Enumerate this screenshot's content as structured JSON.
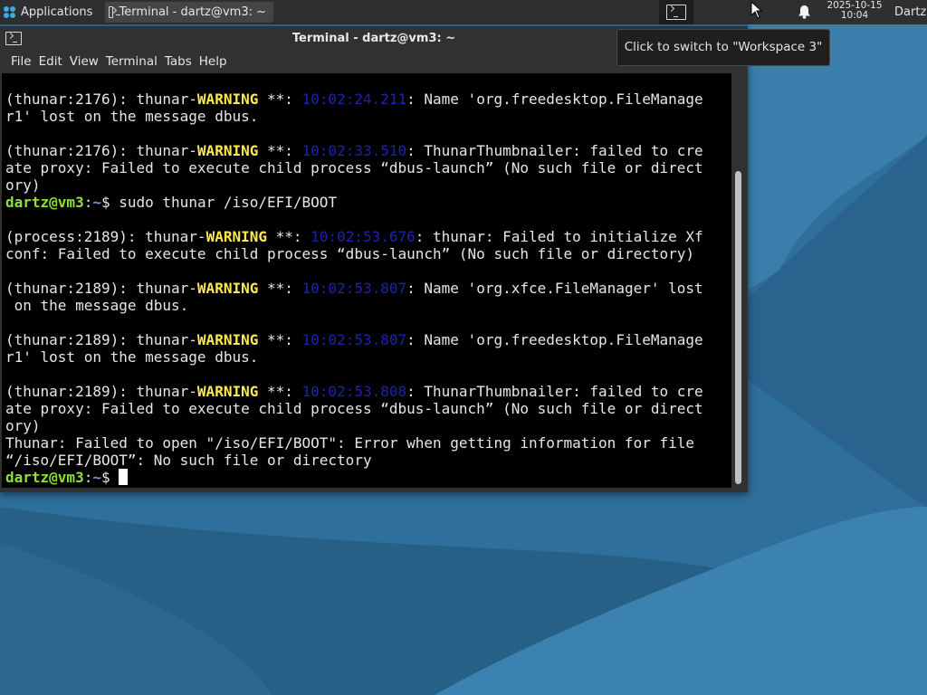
{
  "panel": {
    "apps_label": "Applications",
    "task_title": "Terminal - dartz@vm3: ~",
    "tooltip": "Click to switch to \"Workspace 3\"",
    "clock_date": "2025-10-15",
    "clock_time": "10:04",
    "user": "Dartz",
    "icons": [
      "xfce-logo-icon",
      "terminal-icon",
      "pointer-icon",
      "bell-icon"
    ]
  },
  "window": {
    "title": "Terminal - dartz@vm3: ~",
    "menu": [
      "File",
      "Edit",
      "View",
      "Terminal",
      "Tabs",
      "Help"
    ]
  },
  "terminal": {
    "lines": [
      "",
      "(thunar:2176): thunar-|WARNING| **: |10:02:24.211|: Name 'org.freedesktop.FileManage",
      "r1' lost on the message dbus.",
      "",
      "(thunar:2176): thunar-|WARNING| **: |10:02:33.510|: ThunarThumbnailer: failed to cre",
      "ate proxy: Failed to execute child process “dbus-launch” (No such file or direct",
      "ory)",
      "@@sudo thunar /iso/EFI/BOOT",
      "",
      "(process:2189): thunar-|WARNING| **: |10:02:53.676|: thunar: Failed to initialize Xf",
      "conf: Failed to execute child process “dbus-launch” (No such file or directory)",
      "",
      "(thunar:2189): thunar-|WARNING| **: |10:02:53.807|: Name 'org.xfce.FileManager' lost",
      " on the message dbus.",
      "",
      "(thunar:2189): thunar-|WARNING| **: |10:02:53.807|: Name 'org.freedesktop.FileManage",
      "r1' lost on the message dbus.",
      "",
      "(thunar:2189): thunar-|WARNING| **: |10:02:53.808|: ThunarThumbnailer: failed to cre",
      "ate proxy: Failed to execute child process “dbus-launch” (No such file or direct",
      "ory)",
      "Thunar: Failed to open \"/iso/EFI/BOOT\": Error when getting information for file",
      "“/iso/EFI/BOOT”: No such file or directory",
      "@@"
    ],
    "prompt_user": "dartz@vm3",
    "prompt_path": "~",
    "prompt_symbol": "$ "
  },
  "colors": {
    "warning": "#fce94f",
    "timestamp": "#1b24a8",
    "prompt_user": "#8ae234",
    "prompt_path": "#729fcf",
    "terminal_bg": "#000000",
    "desktop": "#2d6d98"
  }
}
